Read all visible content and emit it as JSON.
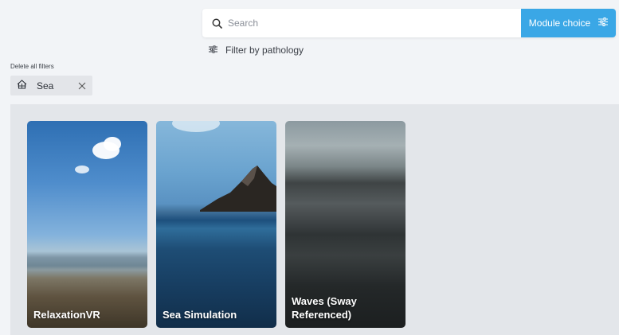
{
  "search": {
    "placeholder": "Search"
  },
  "module_choice": {
    "label": "Module choice"
  },
  "filter_pathology": {
    "label": "Filter by pathology"
  },
  "filters": {
    "delete_all_label": "Delete all filters",
    "chips": [
      {
        "label": "Sea"
      }
    ]
  },
  "cards": [
    {
      "title": "RelaxationVR"
    },
    {
      "title": "Sea Simulation"
    },
    {
      "title": "Waves (Sway Referenced)"
    }
  ],
  "colors": {
    "accent": "#3aa7e6",
    "background": "#f2f4f7",
    "grid_background": "#e3e6ea",
    "chip_background": "#e3e5e9"
  },
  "icons": {
    "search": "search-icon",
    "module_choice": "sliders-icon",
    "filter_pathology": "sliders-icon",
    "chip": "home-icon",
    "chip_remove": "close-icon"
  }
}
